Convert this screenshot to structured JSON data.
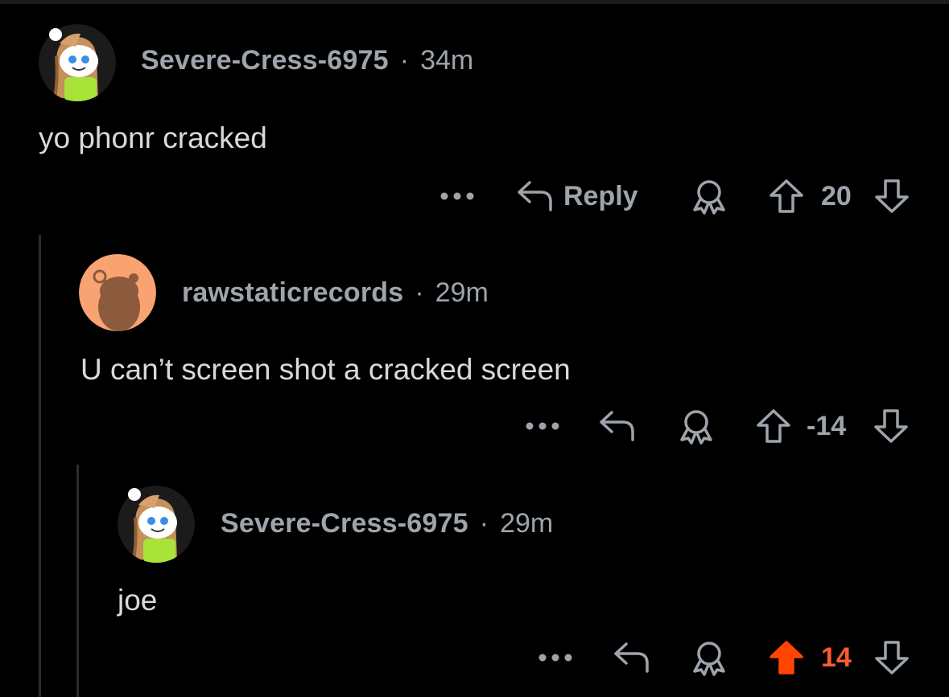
{
  "comments": [
    {
      "username": "Severe-Cress-6975",
      "separator": "·",
      "age": "34m",
      "body": "yo phonr cracked",
      "reply_label": "Reply",
      "score": "20",
      "vote_state": "none",
      "avatar": "snoo-long-hair-avatar"
    },
    {
      "username": "rawstaticrecords",
      "separator": "·",
      "age": "29m",
      "body": "U can’t screen shot a cracked screen",
      "score": "-14",
      "vote_state": "none",
      "avatar": "snoo-silhouette-avatar"
    },
    {
      "username": "Severe-Cress-6975",
      "separator": "·",
      "age": "29m",
      "body": "joe",
      "score": "14",
      "vote_state": "upvoted",
      "avatar": "snoo-long-hair-avatar"
    }
  ],
  "colors": {
    "background": "#000000",
    "meta_text": "#9ea4ab",
    "body_text": "#d7dadc",
    "upvote_active": "#ff4500",
    "thread_line": "#2a2c2e",
    "avatar_orange": "#f8a371"
  },
  "icons": [
    "more-icon",
    "reply-icon",
    "award-icon",
    "upvote-icon",
    "downvote-icon"
  ]
}
